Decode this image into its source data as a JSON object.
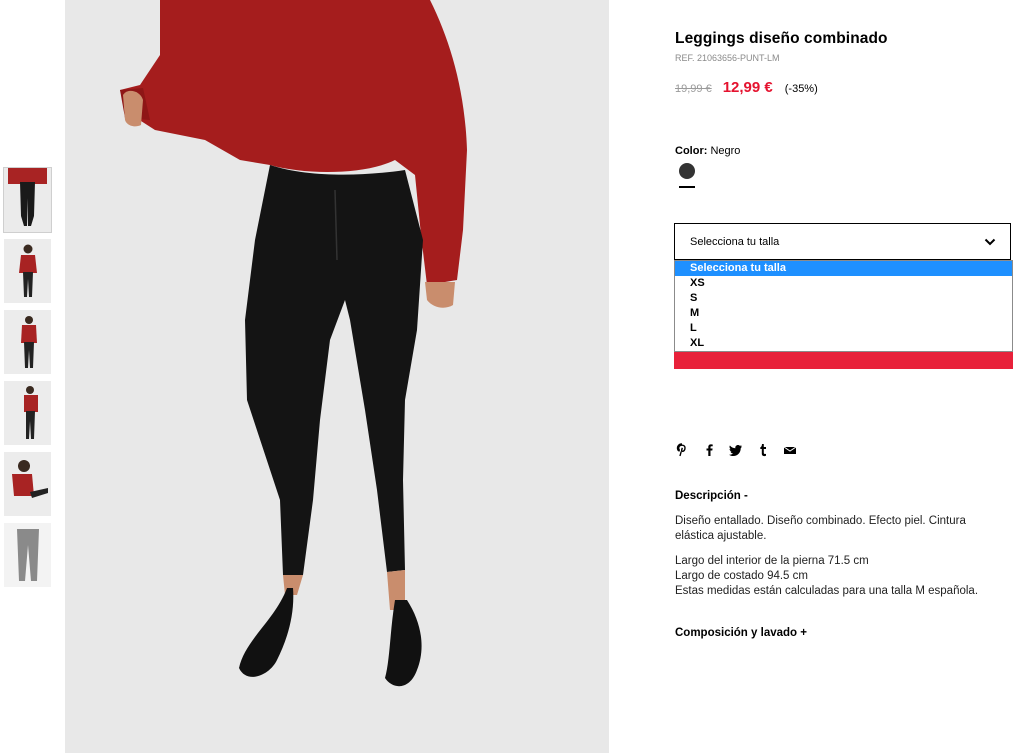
{
  "product": {
    "title": "Leggings diseño combinado",
    "ref": "REF. 21063656-PUNT-LM",
    "old_price": "19,99 €",
    "new_price": "12,99 €",
    "discount": "(-35%)"
  },
  "color": {
    "label": "Color:",
    "value": "Negro",
    "swatch_color": "#333333"
  },
  "size_select": {
    "selected": "Selecciona tu talla",
    "options": [
      "Selecciona tu talla",
      "XS",
      "S",
      "M",
      "L",
      "XL"
    ]
  },
  "share_icons": [
    "pinterest-icon",
    "facebook-icon",
    "twitter-icon",
    "tumblr-icon",
    "mail-icon"
  ],
  "description": {
    "heading": "Descripción -",
    "para1": "Diseño entallado. Diseño combinado. Efecto piel. Cintura elástica ajustable.",
    "line1": "Largo del interior de la pierna 71.5 cm",
    "line2": "Largo de costado 94.5 cm",
    "line3": "Estas medidas están calculadas para una talla M española."
  },
  "composition": {
    "heading": "Composición y lavado +"
  },
  "colors": {
    "accent": "#e8213a",
    "price_red": "#e5132f",
    "dropdown_highlight": "#1e90ff"
  }
}
